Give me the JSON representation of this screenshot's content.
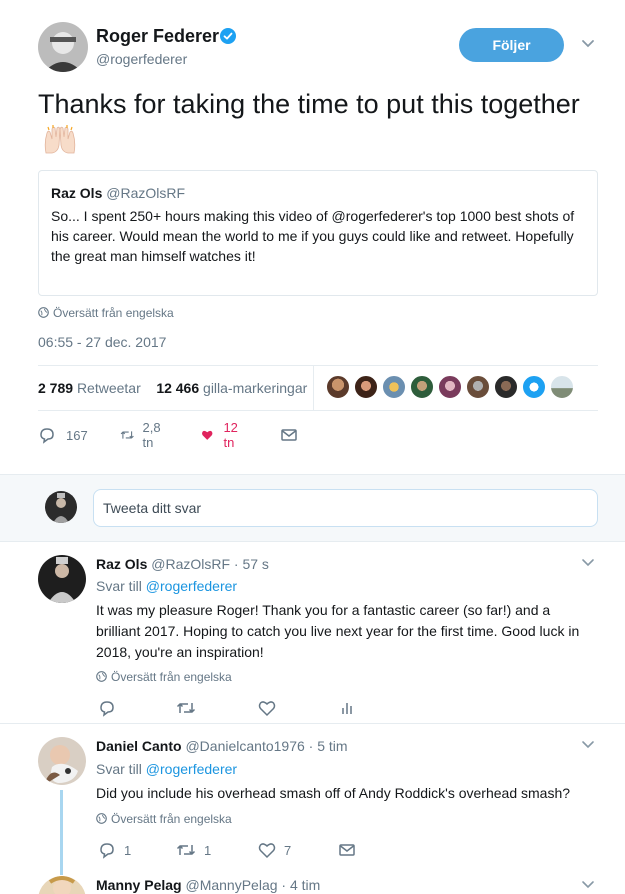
{
  "tweet": {
    "author_name": "Roger Federer",
    "author_handle": "@rogerfederer",
    "follow_label": "Följer",
    "text": "Thanks for taking the time to put this together",
    "quote": {
      "name": "Raz Ols",
      "handle": "@RazOlsRF",
      "text": "So... I spent 250+ hours making this video of @rogerfederer's top 1000 best shots of his career. Would mean the world to me if you guys could like and retweet. Hopefully the great man himself watches it!"
    },
    "translate_label": "Översätt från engelska",
    "timestamp": "06:55 - 27 dec. 2017",
    "retweet_count": "2 789",
    "retweet_label": "Retweetar",
    "like_count": "12 466",
    "like_label": "gilla-markeringar",
    "actions": {
      "replies": "167",
      "retweets": "2,8 tn",
      "likes": "12 tn"
    }
  },
  "reply_box": {
    "placeholder": "Tweeta ditt svar"
  },
  "replies": [
    {
      "name": "Raz Ols",
      "handle": "@RazOlsRF",
      "time": "· 57 s",
      "reply_to_label": "Svar till",
      "reply_to": "@rogerfederer",
      "text": "It was my pleasure Roger! Thank you for a fantastic career (so far!) and a brilliant 2017. Hoping to catch you live next year for the first time. Good luck in 2018, you're an inspiration!",
      "translate_label": "Översätt från engelska"
    },
    {
      "name": "Daniel Canto",
      "handle": "@Danielcanto1976",
      "time": "· 5 tim",
      "reply_to_label": "Svar till",
      "reply_to": "@rogerfederer",
      "text": "Did you include his overhead smash off of Andy Roddick's overhead smash?",
      "translate_label": "Översätt från engelska",
      "replies": "1",
      "retweets": "1",
      "likes": "7"
    },
    {
      "name": "Manny Pelag",
      "handle": "@MannyPelag",
      "time": "· 4 tim"
    }
  ],
  "colors": {
    "accent": "#1b95e0",
    "follow_button": "#4aa3df",
    "like_red": "#e0245e",
    "muted": "#657786"
  }
}
